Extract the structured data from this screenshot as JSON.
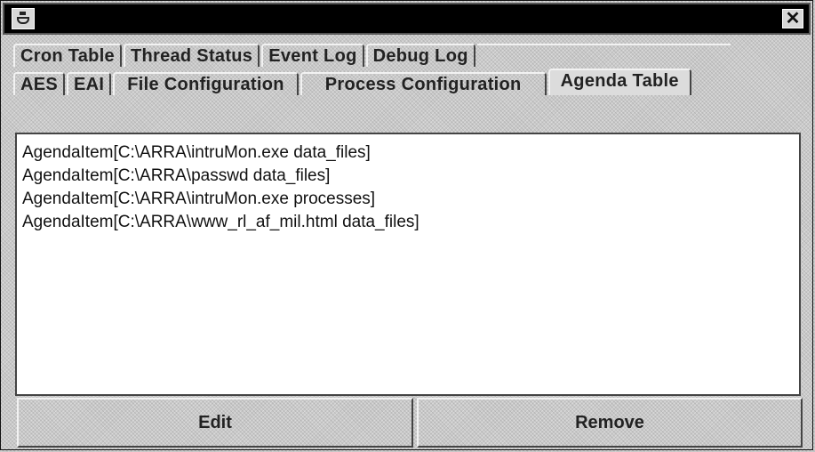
{
  "titlebar": {
    "icon": "java-cup-icon",
    "close_glyph": "✕"
  },
  "tabs_top": [
    "Cron Table",
    "Thread Status",
    "Event Log",
    "Debug Log"
  ],
  "tabs_bottom": [
    "AES",
    "EAI",
    "File Configuration",
    "Process Configuration",
    "Agenda Table"
  ],
  "selected_tab": "Agenda Table",
  "agenda_items": [
    "AgendaItem[C:\\ARRA\\intruMon.exe data_files]",
    "AgendaItem[C:\\ARRA\\passwd data_files]",
    "AgendaItem[C:\\ARRA\\intruMon.exe processes]",
    "AgendaItem[C:\\ARRA\\www_rl_af_mil.html data_files]"
  ],
  "buttons": {
    "edit": "Edit",
    "remove": "Remove"
  }
}
